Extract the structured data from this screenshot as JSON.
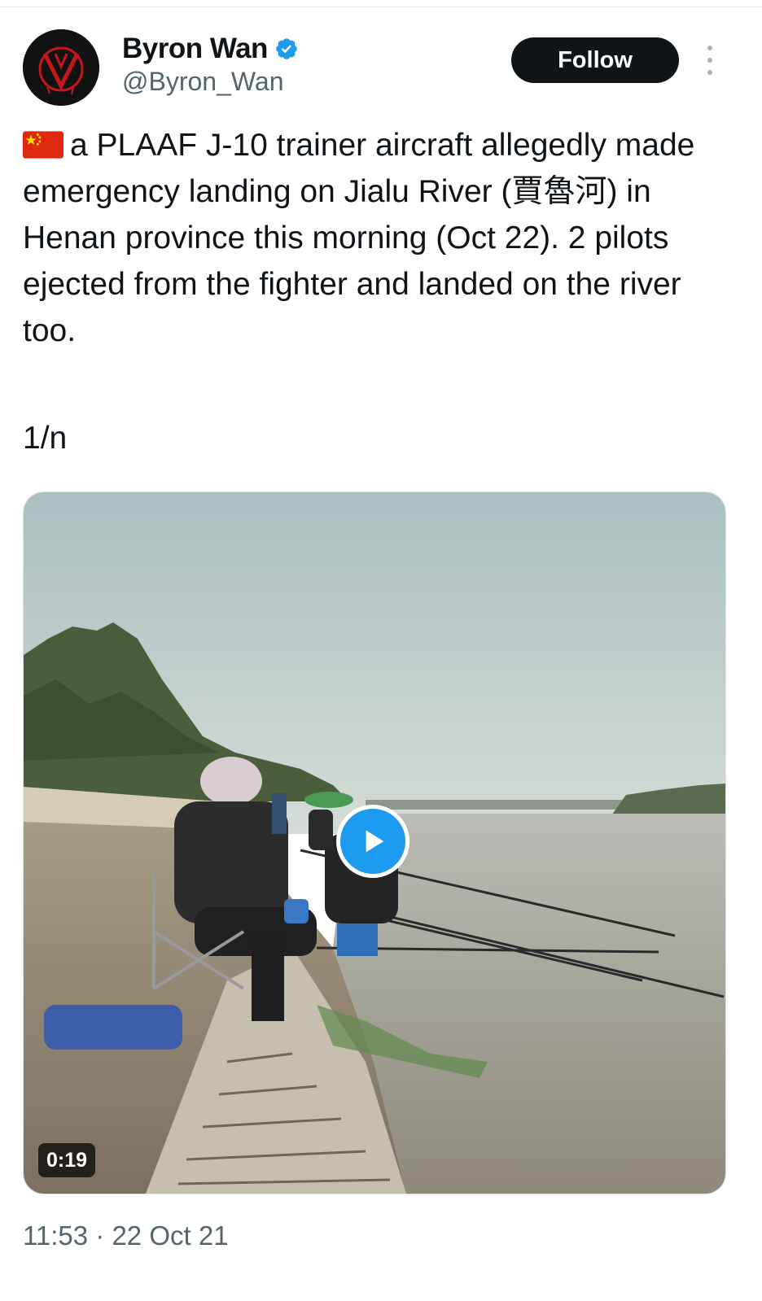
{
  "author": {
    "display_name": "Byron Wan",
    "handle": "@Byron_Wan",
    "verified": true,
    "avatar_icon": "v-mask-logo-icon"
  },
  "actions": {
    "follow_label": "Follow",
    "more_icon": "more-vertical-icon"
  },
  "tweet": {
    "flag_icon": "china-flag-icon",
    "text": "a PLAAF J-10 trainer aircraft allegedly made emergency landing on Jialu River (賈魯河) in Henan province this morning (Oct 22). 2 pilots ejected from the fighter and landed on the river too.",
    "thread_marker": "1/n",
    "timestamp": "11:53 · 22 Oct 21"
  },
  "media": {
    "type": "video",
    "duration": "0:19",
    "play_icon": "play-icon"
  },
  "colors": {
    "accent_blue": "#1d9bf0",
    "follow_bg": "#0f1419",
    "text_primary": "#0f1419",
    "text_secondary": "#536471"
  }
}
